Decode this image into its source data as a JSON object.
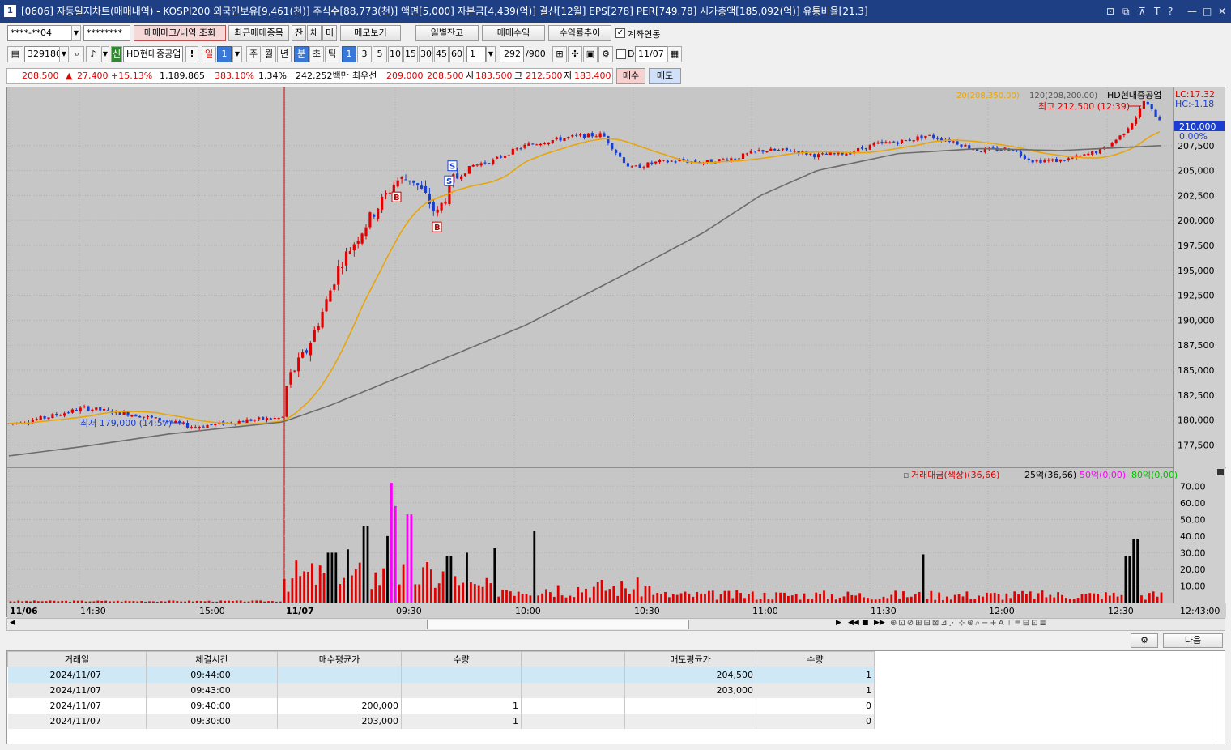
{
  "window": {
    "icon": "1",
    "title": "[0606] 자동일지차트(매매내역) - KOSPI200 외국인보유[9,461(천)] 주식수[88,773(천)] 액면[5,000] 자본금[4,439(억)] 결산[12월] EPS[278] PER[749.78] 시가총액[185,092(억)] 유통비율[21.3]",
    "controls": [
      "⊡",
      "⧉",
      "⊼",
      "T",
      "?",
      "—",
      "□",
      "✕"
    ]
  },
  "toolbar1": {
    "account": "****-**04",
    "password": "********",
    "mark_button": "매매마크/내역 조회",
    "recent_button": "최근매매종목",
    "small_buttons": [
      "잔",
      "체",
      "미"
    ],
    "memo_button": "메모보기",
    "daily_balance_button": "일별잔고",
    "trade_profit_button": "매매수익",
    "return_trend_button": "수익률추이",
    "link_label": "계좌연동"
  },
  "toolbar2": {
    "code": "329180",
    "stock_name": "HD현대중공업",
    "period_unit": "일",
    "period_count": "1",
    "periods": [
      "주",
      "월",
      "년",
      "분",
      "초",
      "틱"
    ],
    "minute_values": [
      "1",
      "3",
      "5",
      "10",
      "15",
      "30",
      "45",
      "60"
    ],
    "interval": "1",
    "count": "292",
    "max_count": "/900",
    "date_label": "D",
    "date": "11/07"
  },
  "quote": {
    "price": "208,500",
    "arrow": "▲",
    "change": "27,400",
    "rate": "+15.13%",
    "volume": "1,189,865",
    "vol_ratio": "383.10%",
    "turnover": "1.34%",
    "amount": "242,252백만",
    "best_label": "최우선",
    "best_ask": "209,000",
    "best_bid": "208,500",
    "open_label": "시",
    "open": "183,500",
    "high_label": "고",
    "high": "212,500",
    "low_label": "저",
    "low": "183,400",
    "buy_button": "매수",
    "sell_button": "매도"
  },
  "chart_data": {
    "type": "candlestick",
    "stock_label": "HD현대중공업",
    "ma_legend": [
      {
        "name": "20(208,350.00)",
        "color": "#e8a50a"
      },
      {
        "name": "120(208,200.00)",
        "color": "#6c6c6c"
      }
    ],
    "lc_label": "LC:17.32",
    "hc_label": "HC:-1.18",
    "high_annotation": "최고 212,500 (12:39)",
    "low_annotation": "최저 179,000 (14:57)",
    "current_price_tag": "210,000",
    "current_rate_tag": "0.00%",
    "y_ticks": [
      "207,500",
      "205,000",
      "202,500",
      "200,000",
      "197,500",
      "195,000",
      "192,500",
      "190,000",
      "187,500",
      "185,000",
      "182,500",
      "180,000",
      "177,500"
    ],
    "x_ticks": [
      "11/06",
      "14:30",
      "15:00",
      "11/07",
      "09:30",
      "10:00",
      "10:30",
      "11:00",
      "11:30",
      "12:00",
      "12:30"
    ],
    "x_time_readout": "12:43:00",
    "ylim": [
      175500,
      213000
    ],
    "trade_marks": [
      {
        "type": "B",
        "time": "09:30",
        "price": 203000
      },
      {
        "type": "B",
        "time": "09:40",
        "price": 200000
      },
      {
        "type": "S",
        "time": "09:43",
        "price": 203000
      },
      {
        "type": "S",
        "time": "09:44",
        "price": 204500
      }
    ],
    "volume_legend": [
      {
        "name": "거래대금(색상)(36,66)",
        "color": "#e00000"
      },
      {
        "name": "25억(36,66)",
        "color": "#000000"
      },
      {
        "name": "50억(0,00)",
        "color": "#ff00ff"
      },
      {
        "name": "80억(0,00)",
        "color": "#00c000"
      }
    ],
    "volume_ticks": [
      "70.00",
      "60.00",
      "50.00",
      "40.00",
      "30.00",
      "20.00",
      "10.00"
    ]
  },
  "grid": {
    "settings_icon": "gear-icon",
    "next_button": "다음",
    "columns": [
      "거래일",
      "체결시간",
      "매수평균가",
      "수량",
      "",
      "매도평균가",
      "수량"
    ],
    "rows": [
      [
        "2024/11/07",
        "09:44:00",
        "",
        "",
        "",
        "204,500",
        "1"
      ],
      [
        "2024/11/07",
        "09:43:00",
        "",
        "",
        "",
        "203,000",
        "1"
      ],
      [
        "2024/11/07",
        "09:40:00",
        "200,000",
        "1",
        "",
        "",
        "0"
      ],
      [
        "2024/11/07",
        "09:30:00",
        "203,000",
        "1",
        "",
        "",
        "0"
      ]
    ]
  }
}
